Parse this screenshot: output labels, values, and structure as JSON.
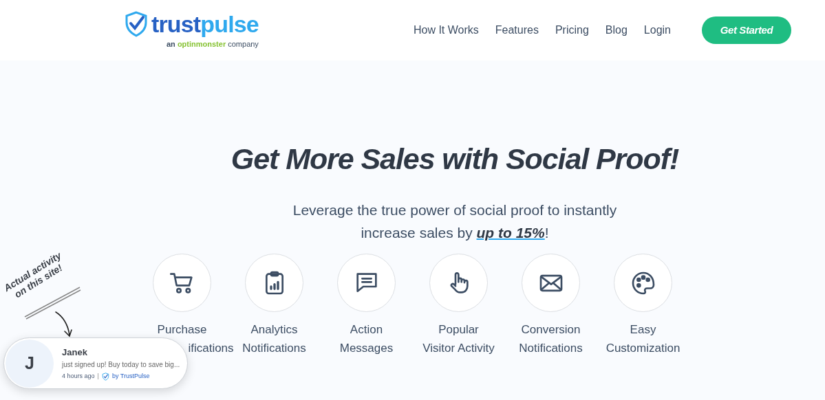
{
  "logo": {
    "name_parts": [
      "trust",
      "pulse"
    ],
    "tagline": [
      "an",
      "optinmonster",
      "company"
    ]
  },
  "nav": [
    {
      "label": "How It Works"
    },
    {
      "label": "Features"
    },
    {
      "label": "Pricing"
    },
    {
      "label": "Blog"
    },
    {
      "label": "Login"
    }
  ],
  "cta": "Get Started",
  "hero": {
    "title": "Get More Sales with Social Proof!",
    "subtitle_lines": [
      "Leverage the true power of social proof to instantly",
      "increase sales by **up to 15%**!"
    ]
  },
  "features": [
    {
      "kind": "cart",
      "lines": [
        "Purchase",
        "ifications"
      ]
    },
    {
      "kind": "analytics",
      "lines": [
        "Analytics",
        "Notifications"
      ]
    },
    {
      "kind": "message",
      "lines": [
        "Action",
        "Messages"
      ]
    },
    {
      "kind": "pointer",
      "lines": [
        "Popular",
        "Visitor Activity"
      ]
    },
    {
      "kind": "mail",
      "lines": [
        "Conversion",
        "Notifications"
      ]
    },
    {
      "kind": "palette",
      "lines": [
        "Easy",
        "Customization"
      ]
    }
  ],
  "annotation": [
    "Actual activity",
    "on this site!"
  ],
  "popup": {
    "initial": "J",
    "name": "Janek",
    "message": "just signed up! Buy today to save big...",
    "time": "4 hours ago",
    "separator": "|",
    "credit": "by TrustPulse"
  }
}
